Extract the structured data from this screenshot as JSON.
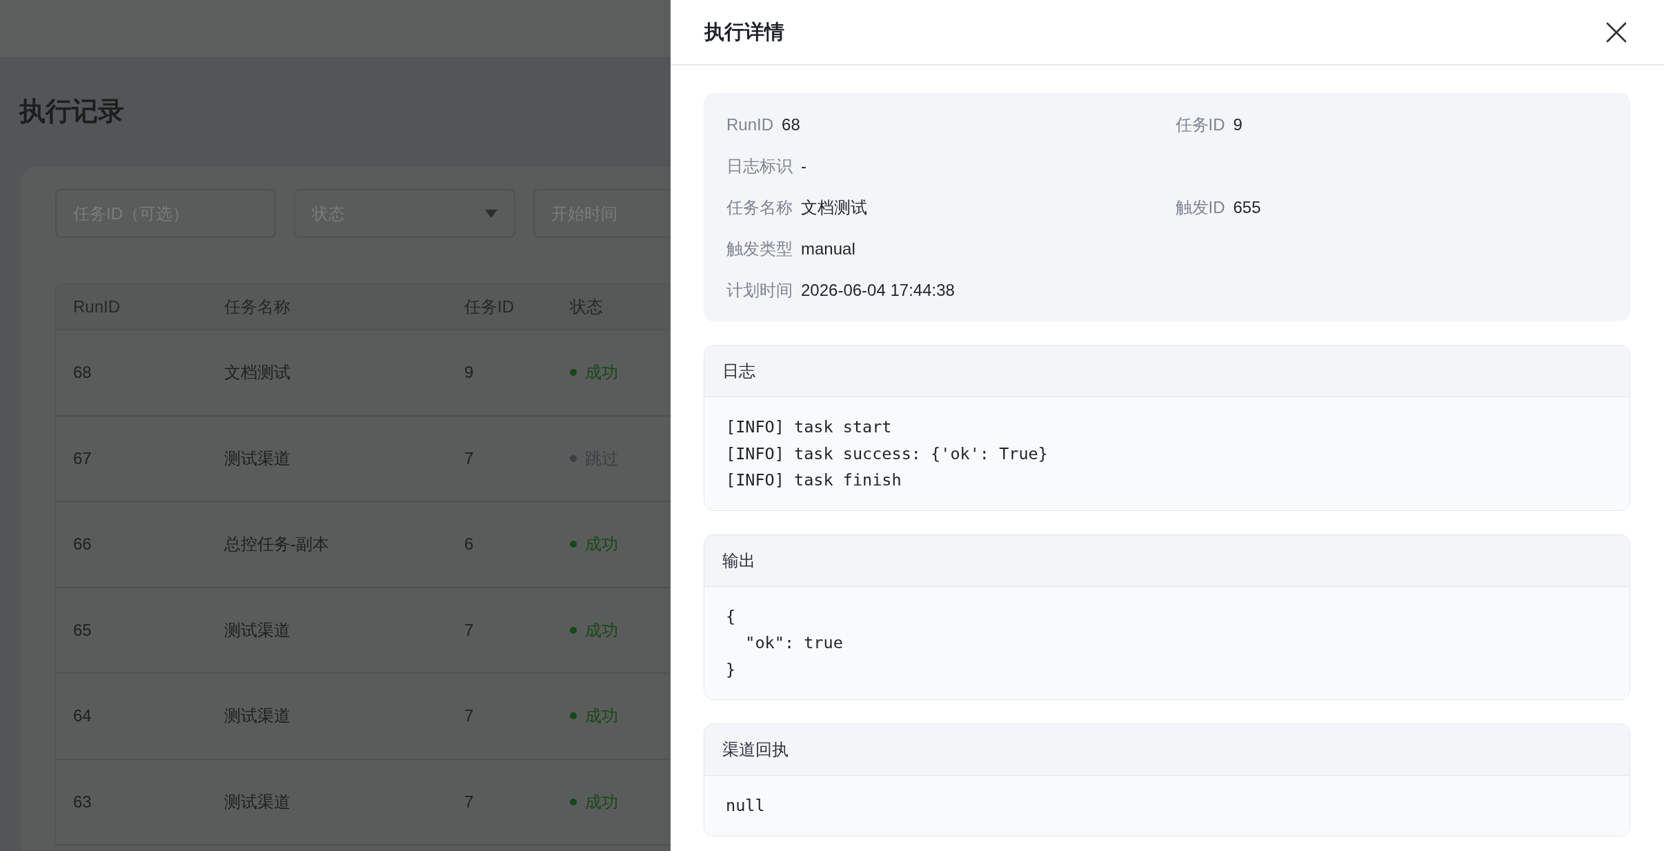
{
  "page": {
    "title": "执行记录",
    "filters": [
      {
        "kind": "input",
        "placeholder": "任务ID（可选）"
      },
      {
        "kind": "select",
        "placeholder": "状态"
      },
      {
        "kind": "input",
        "placeholder": "开始时间"
      }
    ],
    "table": {
      "columns": [
        "RunID",
        "任务名称",
        "任务ID",
        "状态"
      ],
      "rows": [
        {
          "run_id": "68",
          "task_name": "文档测试",
          "task_id": "9",
          "status": {
            "label": "成功",
            "color": "#174818"
          }
        },
        {
          "run_id": "67",
          "task_name": "测试渠道",
          "task_id": "7",
          "status": {
            "label": "跳过",
            "color": "#3c3f44"
          }
        },
        {
          "run_id": "66",
          "task_name": "总控任务-副本",
          "task_id": "6",
          "status": {
            "label": "成功",
            "color": "#174818"
          }
        },
        {
          "run_id": "65",
          "task_name": "测试渠道",
          "task_id": "7",
          "status": {
            "label": "成功",
            "color": "#174818"
          }
        },
        {
          "run_id": "64",
          "task_name": "测试渠道",
          "task_id": "7",
          "status": {
            "label": "成功",
            "color": "#174818"
          }
        },
        {
          "run_id": "63",
          "task_name": "测试渠道",
          "task_id": "7",
          "status": {
            "label": "成功",
            "color": "#174818"
          }
        }
      ]
    }
  },
  "drawer": {
    "title": "执行详情",
    "info_rows": [
      {
        "fields": [
          {
            "label": "RunID",
            "value": "68"
          },
          {
            "label": "任务ID",
            "value": "9"
          }
        ]
      },
      {
        "fields": [
          {
            "label": "日志标识",
            "value": "-"
          }
        ]
      },
      {
        "fields": [
          {
            "label": "任务名称",
            "value": "文档测试"
          },
          {
            "label": "触发ID",
            "value": "655"
          }
        ]
      },
      {
        "fields": [
          {
            "label": "触发类型",
            "value": "manual"
          }
        ]
      },
      {
        "fields": [
          {
            "label": "计划时间",
            "value": "2026-06-04 17:44:38"
          }
        ]
      }
    ],
    "sections": [
      {
        "title": "日志",
        "lines": [
          "[INFO] task start",
          "[INFO] task success: {'ok': True}",
          "[INFO] task finish"
        ]
      },
      {
        "title": "输出",
        "lines": [
          "{",
          "  \"ok\": true",
          "}"
        ]
      },
      {
        "title": "渠道回执",
        "lines": [
          "null"
        ]
      }
    ]
  }
}
